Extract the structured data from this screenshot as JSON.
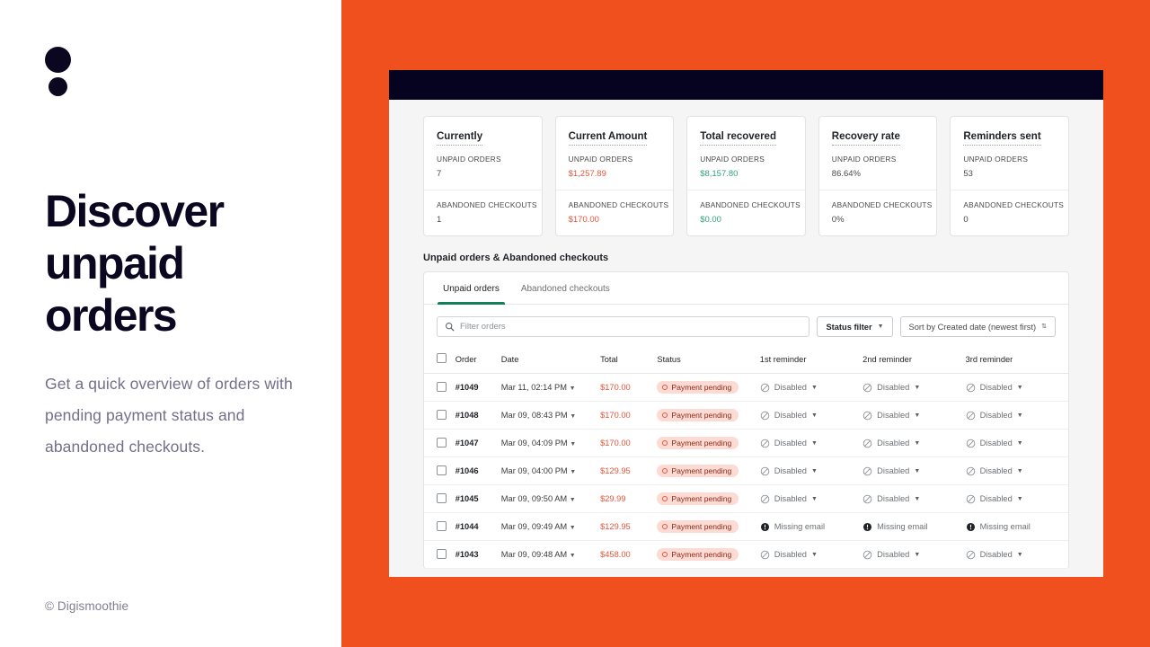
{
  "left": {
    "logo_name": "digismoothie-logo",
    "headline": "Discover unpaid orders",
    "subtext": "Get a quick overview of orders with pending payment status and abandoned checkouts.",
    "credit": "© Digismoothie"
  },
  "colors": {
    "brand_orange": "#F0501E",
    "dark_navy": "#050320",
    "accent_green": "#11805A",
    "alert_red": "#E8553A",
    "success_green": "#2FA37C",
    "badge_bg": "#FCDBD4"
  },
  "app": {
    "stats": [
      {
        "title": "Currently",
        "rows": [
          {
            "label": "UNPAID ORDERS",
            "value": "7",
            "tone": "plain"
          },
          {
            "label": "ABANDONED CHECKOUTS",
            "value": "1",
            "tone": "plain"
          }
        ]
      },
      {
        "title": "Current Amount",
        "rows": [
          {
            "label": "UNPAID ORDERS",
            "value": "$1,257.89",
            "tone": "red"
          },
          {
            "label": "ABANDONED CHECKOUTS",
            "value": "$170.00",
            "tone": "red"
          }
        ]
      },
      {
        "title": "Total recovered",
        "rows": [
          {
            "label": "UNPAID ORDERS",
            "value": "$8,157.80",
            "tone": "green"
          },
          {
            "label": "ABANDONED CHECKOUTS",
            "value": "$0.00",
            "tone": "green"
          }
        ]
      },
      {
        "title": "Recovery rate",
        "rows": [
          {
            "label": "UNPAID ORDERS",
            "value": "86.64%",
            "tone": "plain"
          },
          {
            "label": "ABANDONED CHECKOUTS",
            "value": "0%",
            "tone": "plain"
          }
        ]
      },
      {
        "title": "Reminders sent",
        "rows": [
          {
            "label": "UNPAID ORDERS",
            "value": "53",
            "tone": "plain"
          },
          {
            "label": "ABANDONED CHECKOUTS",
            "value": "0",
            "tone": "plain"
          }
        ]
      }
    ],
    "section_title": "Unpaid orders & Abandoned checkouts",
    "tabs": [
      {
        "label": "Unpaid orders",
        "active": true
      },
      {
        "label": "Abandoned checkouts",
        "active": false
      }
    ],
    "search": {
      "placeholder": "Filter orders",
      "value": "",
      "icon": "search-icon"
    },
    "status_filter_label": "Status filter",
    "sort_label": "Sort by Created date (newest first)",
    "table": {
      "columns": [
        "Order",
        "Date",
        "Total",
        "Status",
        "1st reminder",
        "2nd reminder",
        "3rd reminder"
      ],
      "rows": [
        {
          "order": "#1049",
          "date": "Mar 11, 02:14 PM",
          "total": "$170.00",
          "status": "Payment pending",
          "r1": "Disabled",
          "r2": "Disabled",
          "r3": "Disabled",
          "reminder_state": "disabled"
        },
        {
          "order": "#1048",
          "date": "Mar 09, 08:43 PM",
          "total": "$170.00",
          "status": "Payment pending",
          "r1": "Disabled",
          "r2": "Disabled",
          "r3": "Disabled",
          "reminder_state": "disabled"
        },
        {
          "order": "#1047",
          "date": "Mar 09, 04:09 PM",
          "total": "$170.00",
          "status": "Payment pending",
          "r1": "Disabled",
          "r2": "Disabled",
          "r3": "Disabled",
          "reminder_state": "disabled"
        },
        {
          "order": "#1046",
          "date": "Mar 09, 04:00 PM",
          "total": "$129.95",
          "status": "Payment pending",
          "r1": "Disabled",
          "r2": "Disabled",
          "r3": "Disabled",
          "reminder_state": "disabled"
        },
        {
          "order": "#1045",
          "date": "Mar 09, 09:50 AM",
          "total": "$29.99",
          "status": "Payment pending",
          "r1": "Disabled",
          "r2": "Disabled",
          "r3": "Disabled",
          "reminder_state": "disabled"
        },
        {
          "order": "#1044",
          "date": "Mar 09, 09:49 AM",
          "total": "$129.95",
          "status": "Payment pending",
          "r1": "Missing email",
          "r2": "Missing email",
          "r3": "Missing email",
          "reminder_state": "missing"
        },
        {
          "order": "#1043",
          "date": "Mar 09, 09:48 AM",
          "total": "$458.00",
          "status": "Payment pending",
          "r1": "Disabled",
          "r2": "Disabled",
          "r3": "Disabled",
          "reminder_state": "disabled"
        }
      ]
    }
  }
}
